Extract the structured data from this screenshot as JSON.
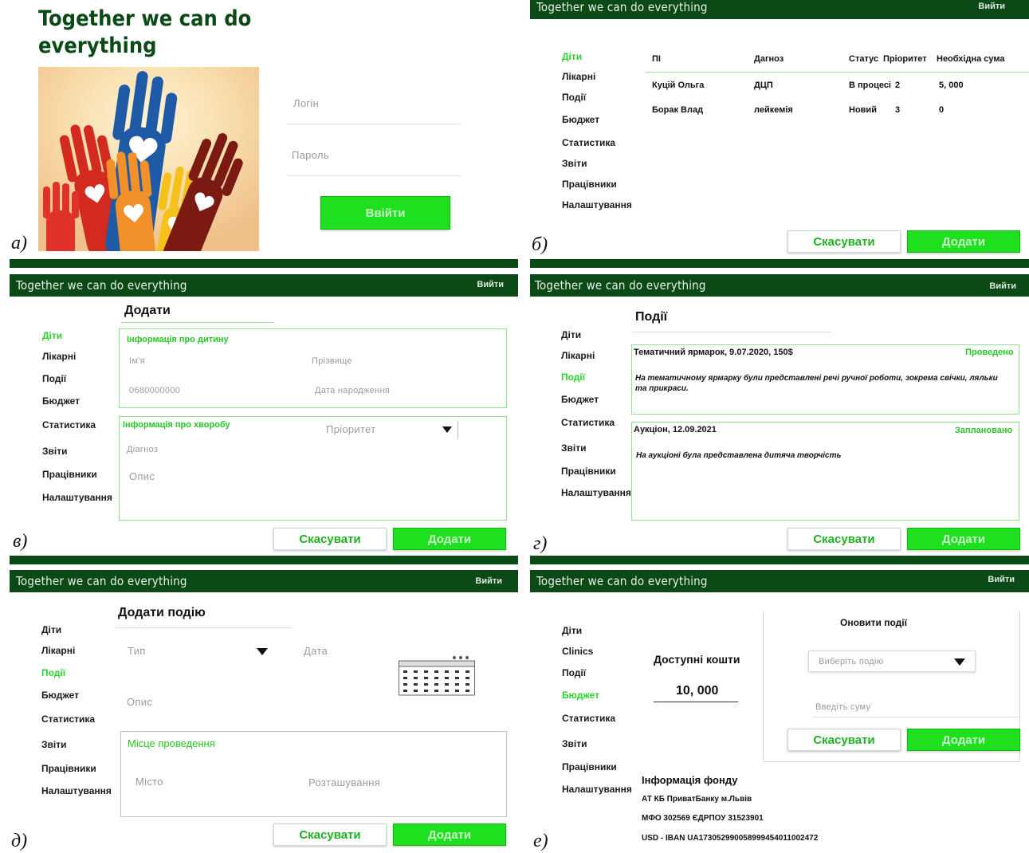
{
  "app": {
    "title": "Together we can do everything",
    "logout": "Вийти"
  },
  "colors": {
    "header": "#0b4a17",
    "accent": "#1ee01e",
    "active": "#2bd32b"
  },
  "captions": {
    "a": "а)",
    "b": "б)",
    "c": "в)",
    "d": "г)",
    "e": "д)",
    "f": "е)"
  },
  "nav": {
    "children": "Діти",
    "hospitals": "Лікарні",
    "clinics": "Clinics",
    "events": "Події",
    "budget": "Бюджет",
    "stats": "Статистика",
    "reports": "Звіти",
    "workers": "Працівники",
    "settings": "Налаштування"
  },
  "buttons": {
    "cancel": "Скасувати",
    "add": "Додати",
    "login": "Ввійти"
  },
  "login": {
    "slogan_line1": "Together we can do",
    "slogan_line2": "everything",
    "login_placeholder": "Логін",
    "password_placeholder": "Пароль",
    "image": "hands-hearts-image"
  },
  "children_table": {
    "headers": [
      "ПІ",
      "Дагноз",
      "Статус",
      "Пріоритет",
      "Необхідна сума"
    ],
    "rows": [
      [
        "Куцій Ольга",
        "ДЦП",
        "В процесі",
        "2",
        "5, 000"
      ],
      [
        "Борак Влад",
        "лейкемія",
        "Новий",
        "3",
        "0"
      ]
    ]
  },
  "add_child": {
    "heading": "Додати",
    "child_section": "Інформація про дитину",
    "first_name": "Ім'я",
    "last_name": "Прізвище",
    "phone": "0680000000",
    "birth_date": "Дата народження",
    "disease_section": "Інформація про хворобу",
    "priority": "Пріоритет",
    "diagnosis": "Діагноз",
    "description": "Опис"
  },
  "events": {
    "heading": "Події",
    "list": [
      {
        "title": "Тематичний ярмарок, 9.07.2020, 150$",
        "status": "Проведено",
        "text": "На тематичному ярмарку були представлені речі ручної роботи, зокрема свічки, ляльки та прикраси."
      },
      {
        "title": "Аукціон, 12.09.2021",
        "status": "Заплановано",
        "text": "На аукціоні була представлена дитяча творчість"
      }
    ]
  },
  "add_event": {
    "heading": "Додати подію",
    "type": "Тип",
    "date": "Дата",
    "description": "Опис",
    "venue_section": "Місце проведення",
    "city": "Місто",
    "location": "Розташування"
  },
  "budget": {
    "available_label": "Доступні кошти",
    "available_value": "10, 000",
    "update_heading": "Оновити події",
    "select_event": "Виберіть подію",
    "enter_amount": "Введіть суму",
    "fund_heading": "Інформація фонду",
    "fund_line1": "АТ КБ  ПриватБанку м.Львів",
    "fund_line2": "МФО 302569 ЄДРПОУ 31523901",
    "fund_line3": "USD - IBAN UA173052990058999454011002472"
  }
}
